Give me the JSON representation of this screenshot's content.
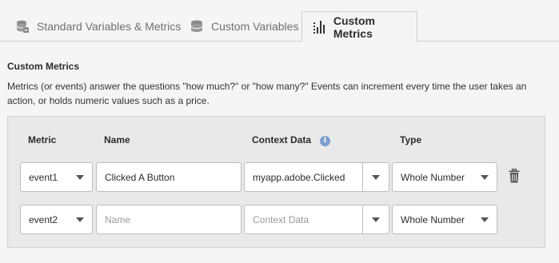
{
  "tabs": [
    {
      "label": "Standard Variables & Metrics",
      "icon": "database-icon",
      "active": false
    },
    {
      "label": "Custom Variables",
      "icon": "database-icon",
      "active": false
    },
    {
      "label": "Custom Metrics",
      "icon": "bar-chart-icon",
      "active": true
    }
  ],
  "section": {
    "title": "Custom Metrics",
    "description": "Metrics (or events) answer the questions \"how much?\" or \"how many?\" Events can increment every time the user takes an action, or holds numeric values such as a price."
  },
  "table": {
    "headers": {
      "metric": "Metric",
      "name": "Name",
      "context": "Context Data",
      "type": "Type"
    },
    "rows": [
      {
        "metric": "event1",
        "name": "Clicked A Button",
        "name_placeholder": "Name",
        "context": "myapp.adobe.Clicked",
        "context_placeholder": "Context Data",
        "type": "Whole Number"
      },
      {
        "metric": "event2",
        "name": "",
        "name_placeholder": "Name",
        "context": "",
        "context_placeholder": "Context Data",
        "type": "Whole Number"
      }
    ]
  },
  "colors": {
    "accent_info": "#7a9fd0",
    "panel_bg": "#e9e9e9",
    "page_bg": "#f5f5f5"
  }
}
